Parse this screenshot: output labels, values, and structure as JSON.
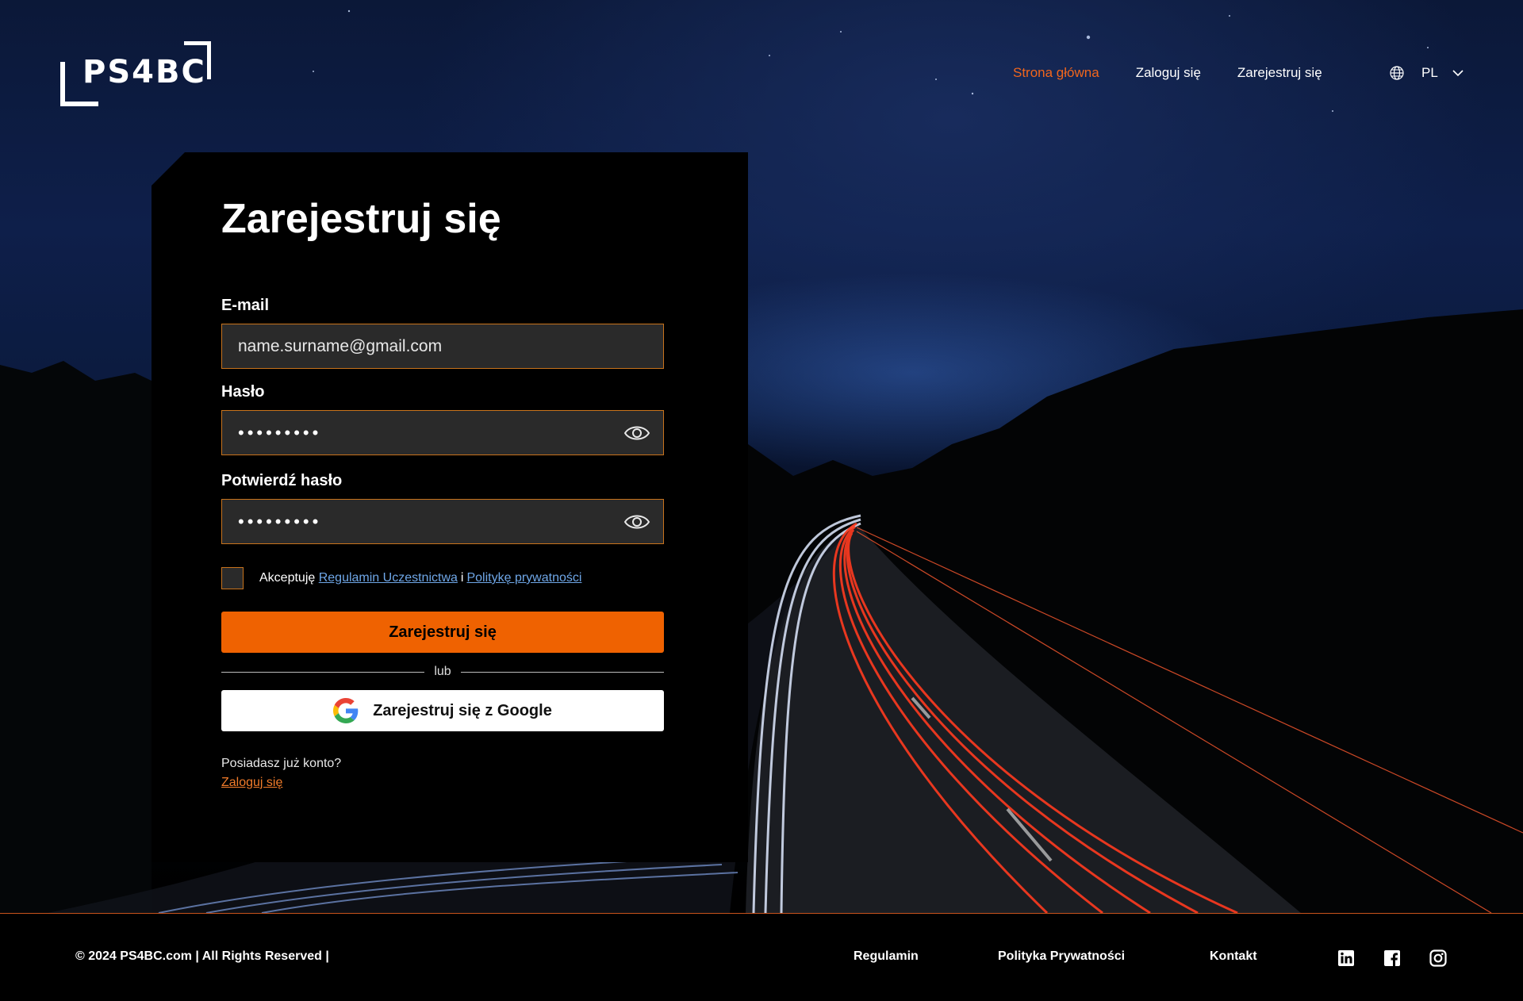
{
  "header": {
    "logo_text": "PS4BC",
    "nav": [
      {
        "label": "Strona główna",
        "active": true
      },
      {
        "label": "Zaloguj się",
        "active": false
      },
      {
        "label": "Zarejestruj się",
        "active": false
      }
    ],
    "language": "PL",
    "language_icon": "globe-icon"
  },
  "form": {
    "title": "Zarejestruj się",
    "email_label": "E-mail",
    "email_value": "name.surname@gmail.com",
    "password_label": "Hasło",
    "password_value": "•••••••••",
    "confirm_label": "Potwierdź hasło",
    "confirm_value": "•••••••••",
    "consent_prefix": "Akceptuję",
    "consent_terms": "Regulamin Uczestnictwa",
    "consent_and": "i",
    "consent_privacy": "Politykę prywatności",
    "submit_label": "Zarejestruj się",
    "divider_text": "lub",
    "google_label": "Zarejestruj się z Google",
    "have_account": "Posiadasz już konto?",
    "login_link": "Zaloguj się"
  },
  "footer": {
    "copyright": "© 2024 PS4BC.com | All Rights Reserved |",
    "links": [
      "Regulamin",
      "Polityka Prywatności",
      "Kontakt"
    ],
    "social_icons": [
      "linkedin-icon",
      "facebook-icon",
      "instagram-icon"
    ]
  },
  "colors": {
    "accent": "#ef6201",
    "active_nav": "#f2661c",
    "link": "#6fa7e8",
    "field_border": "#c8731c"
  }
}
